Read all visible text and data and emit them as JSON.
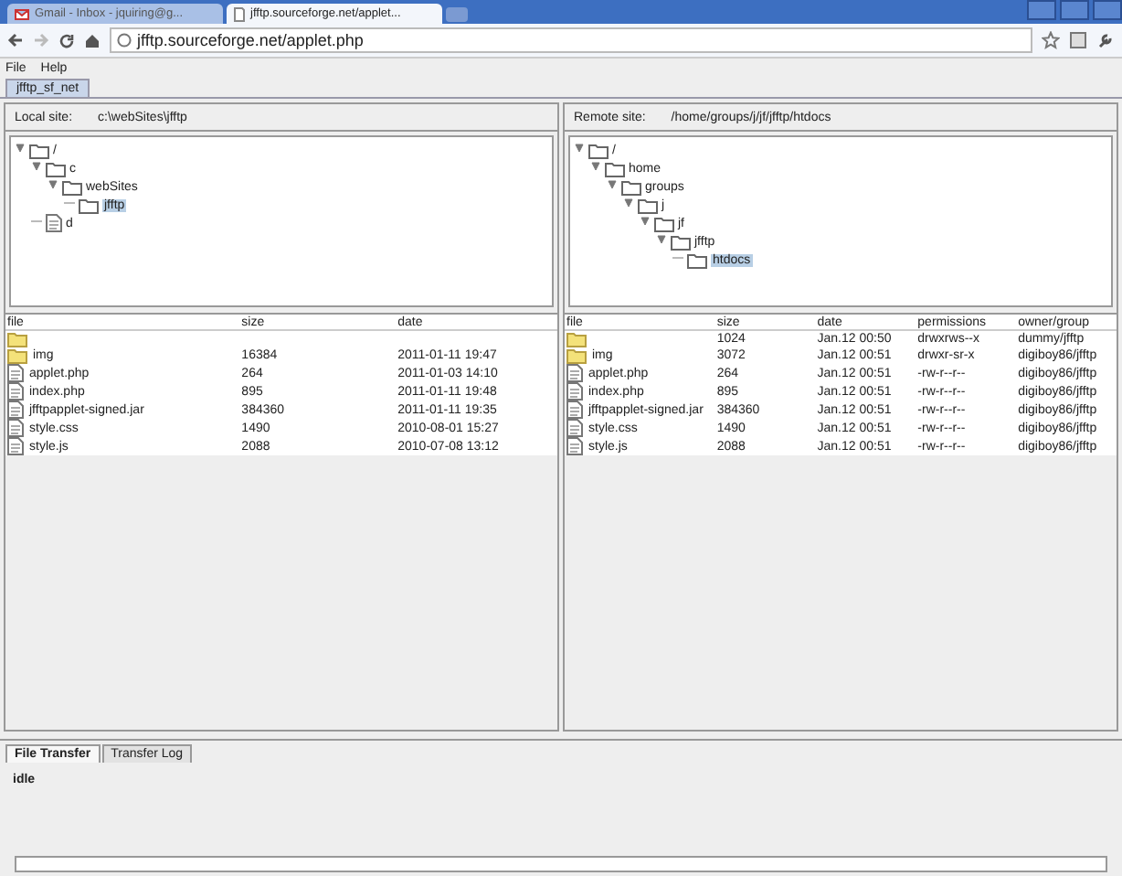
{
  "browser": {
    "tabs": [
      {
        "title": "Gmail - Inbox - jquiring@g...",
        "kind": "mail",
        "selected": false
      },
      {
        "title": "jfftp.sourceforge.net/applet...",
        "kind": "page",
        "selected": true
      }
    ],
    "address": "jfftp.sourceforge.net/applet.php"
  },
  "menu": [
    "File",
    "Help"
  ],
  "session_tabs": [
    {
      "label": "jfftp_sf_net",
      "selected": true
    }
  ],
  "panes": [
    {
      "site_label": "Local site:",
      "site_path": "c:\\webSites\\jfftp",
      "tree": [
        {
          "label": "/",
          "kind": "folder",
          "expanded": true,
          "selected": false,
          "children": [
            {
              "label": "c",
              "kind": "folder",
              "expanded": true,
              "selected": false,
              "children": [
                {
                  "label": "webSites",
                  "kind": "folder",
                  "expanded": true,
                  "selected": false,
                  "children": [
                    {
                      "label": "jfftp",
                      "kind": "folder",
                      "expanded": false,
                      "selected": true
                    }
                  ]
                }
              ]
            },
            {
              "label": "d",
              "kind": "file",
              "expanded": false,
              "selected": false
            }
          ]
        }
      ],
      "columns": [
        "file",
        "size",
        "date"
      ],
      "rows": [
        {
          "kind": "folder",
          "cells": []
        },
        {
          "kind": "folder",
          "cells": [
            "img",
            "16384",
            "2011-01-11 19:47"
          ]
        },
        {
          "kind": "file",
          "cells": [
            "applet.php",
            "264",
            "2011-01-03 14:10"
          ]
        },
        {
          "kind": "file",
          "cells": [
            "index.php",
            "895",
            "2011-01-11 19:48"
          ]
        },
        {
          "kind": "file",
          "cells": [
            "jfftpapplet-signed.jar",
            "384360",
            "2011-01-11 19:35"
          ]
        },
        {
          "kind": "file",
          "cells": [
            "style.css",
            "1490",
            "2010-08-01 15:27"
          ]
        },
        {
          "kind": "file",
          "cells": [
            "style.js",
            "2088",
            "2010-07-08 13:12"
          ]
        }
      ]
    },
    {
      "site_label": "Remote site:",
      "site_path": "/home/groups/j/jf/jfftp/htdocs",
      "tree": [
        {
          "label": "/",
          "kind": "folder",
          "expanded": true,
          "selected": false,
          "children": [
            {
              "label": "home",
              "kind": "folder",
              "expanded": true,
              "selected": false,
              "children": [
                {
                  "label": "groups",
                  "kind": "folder",
                  "expanded": true,
                  "selected": false,
                  "children": [
                    {
                      "label": "j",
                      "kind": "folder",
                      "expanded": true,
                      "selected": false,
                      "children": [
                        {
                          "label": "jf",
                          "kind": "folder",
                          "expanded": true,
                          "selected": false,
                          "children": [
                            {
                              "label": "jfftp",
                              "kind": "folder",
                              "expanded": true,
                              "selected": false,
                              "children": [
                                {
                                  "label": "htdocs",
                                  "kind": "folder",
                                  "expanded": false,
                                  "selected": true
                                }
                              ]
                            }
                          ]
                        }
                      ]
                    }
                  ]
                }
              ]
            }
          ]
        }
      ],
      "columns": [
        "file",
        "size",
        "date",
        "permissions",
        "owner/group"
      ],
      "rows": [
        {
          "kind": "folder",
          "cells": [
            "",
            "1024",
            "Jan.12 00:50",
            "drwxrws--x",
            "dummy/jfftp"
          ]
        },
        {
          "kind": "folder",
          "cells": [
            "img",
            "3072",
            "Jan.12 00:51",
            "drwxr-sr-x",
            "digiboy86/jfftp"
          ]
        },
        {
          "kind": "file",
          "cells": [
            "applet.php",
            "264",
            "Jan.12 00:51",
            "-rw-r--r--",
            "digiboy86/jfftp"
          ]
        },
        {
          "kind": "file",
          "cells": [
            "index.php",
            "895",
            "Jan.12 00:51",
            "-rw-r--r--",
            "digiboy86/jfftp"
          ]
        },
        {
          "kind": "file",
          "cells": [
            "jfftpapplet-signed.jar",
            "384360",
            "Jan.12 00:51",
            "-rw-r--r--",
            "digiboy86/jfftp"
          ]
        },
        {
          "kind": "file",
          "cells": [
            "style.css",
            "1490",
            "Jan.12 00:51",
            "-rw-r--r--",
            "digiboy86/jfftp"
          ]
        },
        {
          "kind": "file",
          "cells": [
            "style.js",
            "2088",
            "Jan.12 00:51",
            "-rw-r--r--",
            "digiboy86/jfftp"
          ]
        }
      ]
    }
  ],
  "bottom_tabs": [
    {
      "label": "File Transfer",
      "selected": true
    },
    {
      "label": "Transfer Log",
      "selected": false
    }
  ],
  "status": "idle",
  "progress": {
    "level": 0
  }
}
